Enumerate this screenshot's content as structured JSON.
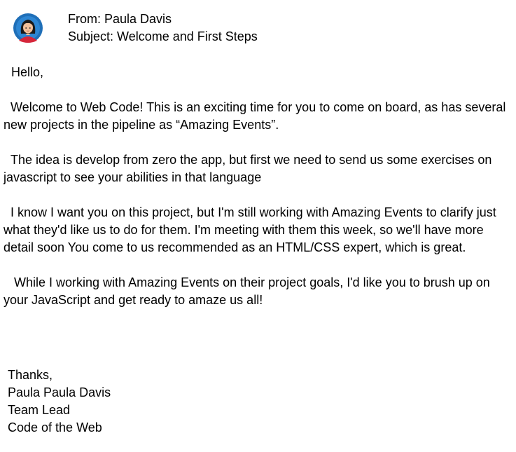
{
  "email": {
    "from_label": "From: Paula Davis",
    "subject_label": "Subject: Welcome and First Steps",
    "greeting": "Hello,",
    "paragraphs": [
      "  Welcome to Web Code! This is an exciting time for you to come on board, as has several new projects in the pipeline as “Amazing Events”.",
      "  The idea is develop from zero the app, but first we need to send us some exercises on javascript to see your abilities in that language",
      "  I know I want you on this project, but I'm still working with Amazing Events to clarify just what they'd like us to do for them. I'm meeting with them this week, so we'll have more detail soon You come to us recommended as an HTML/CSS expert, which is great.",
      "   While I working with Amazing Events on their project goals, I'd like you to brush up on your JavaScript and get ready to amaze us all!"
    ],
    "signoff": [
      "Thanks,",
      "Paula Paula Davis",
      "Team Lead",
      "Code of the Web"
    ]
  },
  "colors": {
    "avatar_ring": "#1f6fb8",
    "avatar_bg": "#ffffff",
    "hair": "#1a1a1a",
    "skin": "#f2c09a",
    "shirt": "#d6263a"
  },
  "icons": {
    "avatar": "person-avatar-icon"
  }
}
